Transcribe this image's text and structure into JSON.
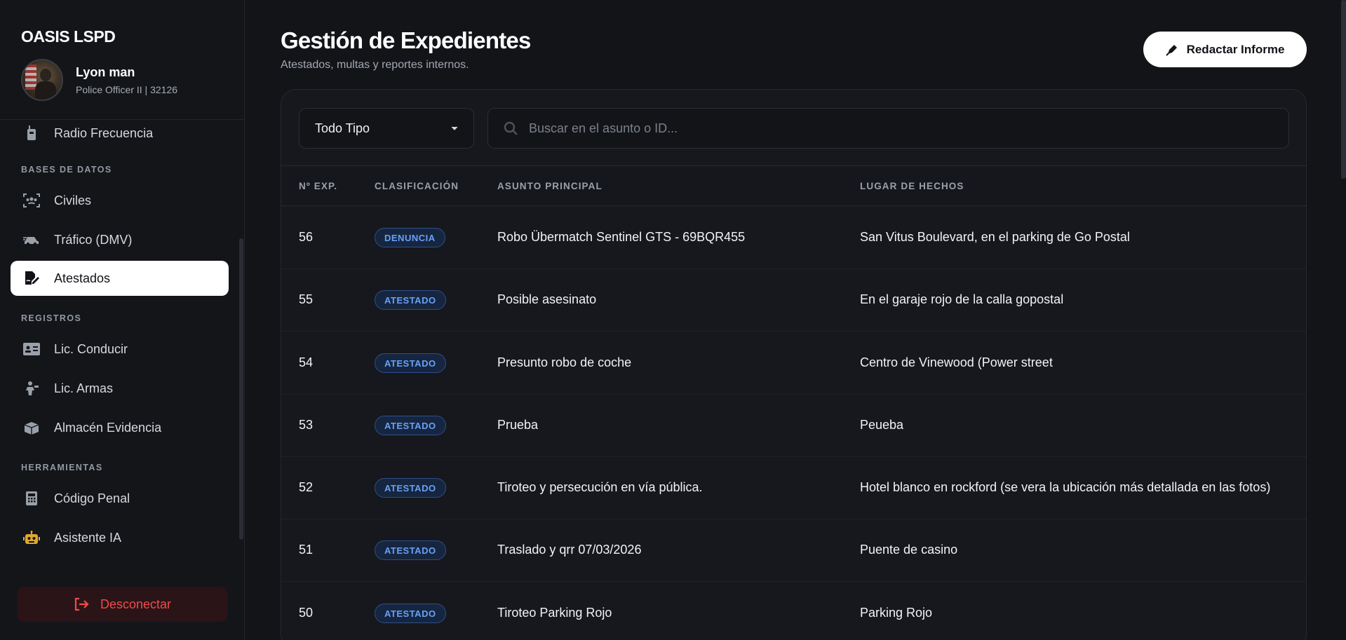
{
  "brand": "OASIS LSPD",
  "user": {
    "name": "Lyon man",
    "role": "Police Officer II | 32126"
  },
  "sidebar": {
    "items": [
      {
        "label": "Radio Frecuencia",
        "icon": "radio-icon"
      },
      {
        "label": "Civiles",
        "icon": "users-icon"
      },
      {
        "label": "Tráfico (DMV)",
        "icon": "car-icon"
      },
      {
        "label": "Atestados",
        "icon": "file-signature-icon",
        "active": true
      },
      {
        "label": "Lic. Conducir",
        "icon": "id-card-icon"
      },
      {
        "label": "Lic. Armas",
        "icon": "gun-icon"
      },
      {
        "label": "Almacén Evidencia",
        "icon": "box-icon"
      },
      {
        "label": "Código Penal",
        "icon": "calculator-icon"
      },
      {
        "label": "Asistente IA",
        "icon": "robot-icon"
      }
    ],
    "sections": {
      "databases": "BASES DE DATOS",
      "records": "REGISTROS",
      "tools": "HERRAMIENTAS"
    },
    "logout": "Desconectar"
  },
  "header": {
    "title": "Gestión de Expedientes",
    "subtitle": "Atestados, multas y reportes internos.",
    "new_button": "Redactar Informe"
  },
  "filters": {
    "type_selected": "Todo Tipo",
    "search_placeholder": "Buscar en el asunto o ID..."
  },
  "table": {
    "columns": [
      "Nº EXP.",
      "CLASIFICACIÓN",
      "ASUNTO PRINCIPAL",
      "LUGAR DE HECHOS"
    ],
    "rows": [
      {
        "id": "56",
        "type": "DENUNCIA",
        "subject": "Robo Übermatch Sentinel GTS - 69BQR455",
        "place": "San Vitus Boulevard, en el parking de Go Postal"
      },
      {
        "id": "55",
        "type": "ATESTADO",
        "subject": "Posible asesinato",
        "place": "En el garaje rojo de la calla gopostal"
      },
      {
        "id": "54",
        "type": "ATESTADO",
        "subject": "Presunto robo de coche",
        "place": "Centro de Vinewood (Power street"
      },
      {
        "id": "53",
        "type": "ATESTADO",
        "subject": "Prueba",
        "place": "Peueba"
      },
      {
        "id": "52",
        "type": "ATESTADO",
        "subject": "Tiroteo y persecución en vía pública.",
        "place": "Hotel blanco en rockford (se vera la ubicación más detallada en las fotos)"
      },
      {
        "id": "51",
        "type": "ATESTADO",
        "subject": "Traslado y qrr 07/03/2026",
        "place": "Puente de casino"
      },
      {
        "id": "50",
        "type": "ATESTADO",
        "subject": "Tiroteo Parking Rojo",
        "place": "Parking Rojo"
      }
    ]
  },
  "colors": {
    "accent_blue": "#6aa0f4",
    "danger": "#f04b4b",
    "background": "#121418"
  }
}
